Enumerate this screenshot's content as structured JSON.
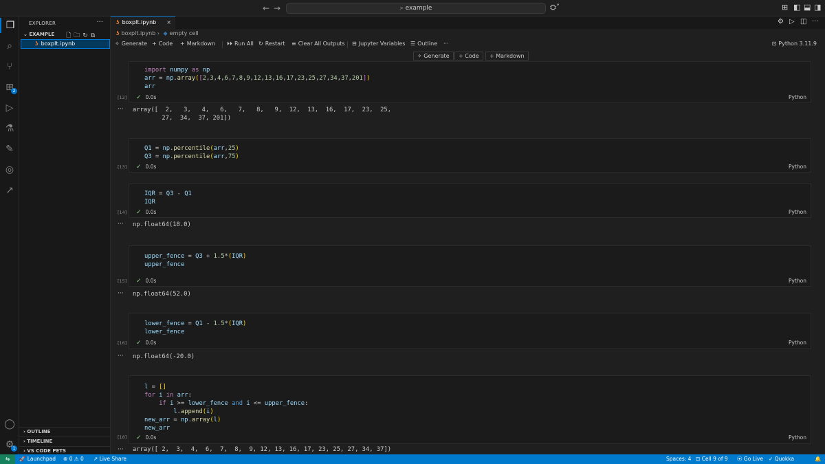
{
  "titlebar": {
    "back_icon": "←",
    "forward_icon": "→",
    "search_text": "example",
    "copilot_label": "⛭˅"
  },
  "activitybar": {
    "items": [
      "explorer",
      "search",
      "source-control",
      "extensions",
      "run-debug",
      "testing",
      "remote",
      "jupyter",
      "live-share"
    ],
    "extensions_badge": "2",
    "settings_badge": "1"
  },
  "sidebar": {
    "header": "EXPLORER",
    "more": "···",
    "folder": "EXAMPLE",
    "file": "boxplt.ipynb",
    "sections": [
      "OUTLINE",
      "TIMELINE",
      "VS CODE PETS"
    ]
  },
  "tab": {
    "label": "boxplt.ipynb",
    "close": "×"
  },
  "breadcrumb": {
    "file": "boxplt.ipynb",
    "sep": "›",
    "cell": "empty cell"
  },
  "toolbar": {
    "generate": "Generate",
    "code": "Code",
    "markdown": "Markdown",
    "run_all": "Run All",
    "restart": "Restart",
    "clear_outputs": "Clear All Outputs",
    "variables": "Jupyter Variables",
    "outline": "Outline",
    "more": "···",
    "kernel": "Python 3.11.9"
  },
  "insert_bar": {
    "generate": "Generate",
    "code": "Code",
    "markdown": "Markdown"
  },
  "cells": [
    {
      "exec": "[12]",
      "time": "0.0s",
      "lang": "Python",
      "output_line1": "array([  2,   3,   4,   6,   7,   8,   9,  12,  13,  16,  17,  23,  25,",
      "output_line2": "        27,  34,  37, 201])"
    },
    {
      "exec": "[13]",
      "time": "0.0s",
      "lang": "Python"
    },
    {
      "exec": "[14]",
      "time": "0.0s",
      "lang": "Python",
      "output": "np.float64(18.0)"
    },
    {
      "exec": "[15]",
      "time": "0.0s",
      "lang": "Python",
      "output": "np.float64(52.0)"
    },
    {
      "exec": "[16]",
      "time": "0.0s",
      "lang": "Python",
      "output": "np.float64(-20.0)"
    },
    {
      "exec": "[18]",
      "time": "0.0s",
      "lang": "Python",
      "output": "array([ 2,  3,  4,  6,  7,  8,  9, 12, 13, 16, 17, 23, 25, 27, 34, 37])"
    }
  ],
  "output_marker": "···",
  "statusbar": {
    "launchpad": "Launchpad",
    "problems": "0",
    "warnings": "0",
    "live_share": "Live Share",
    "spaces": "Spaces: 4",
    "cell": "Cell 9 of 9",
    "go_live": "Go Live",
    "quokka": "Quokka"
  },
  "colors": {
    "accent": "#0078d4",
    "statusbar": "#007acc",
    "remote": "#16825d",
    "success": "#89d185"
  }
}
